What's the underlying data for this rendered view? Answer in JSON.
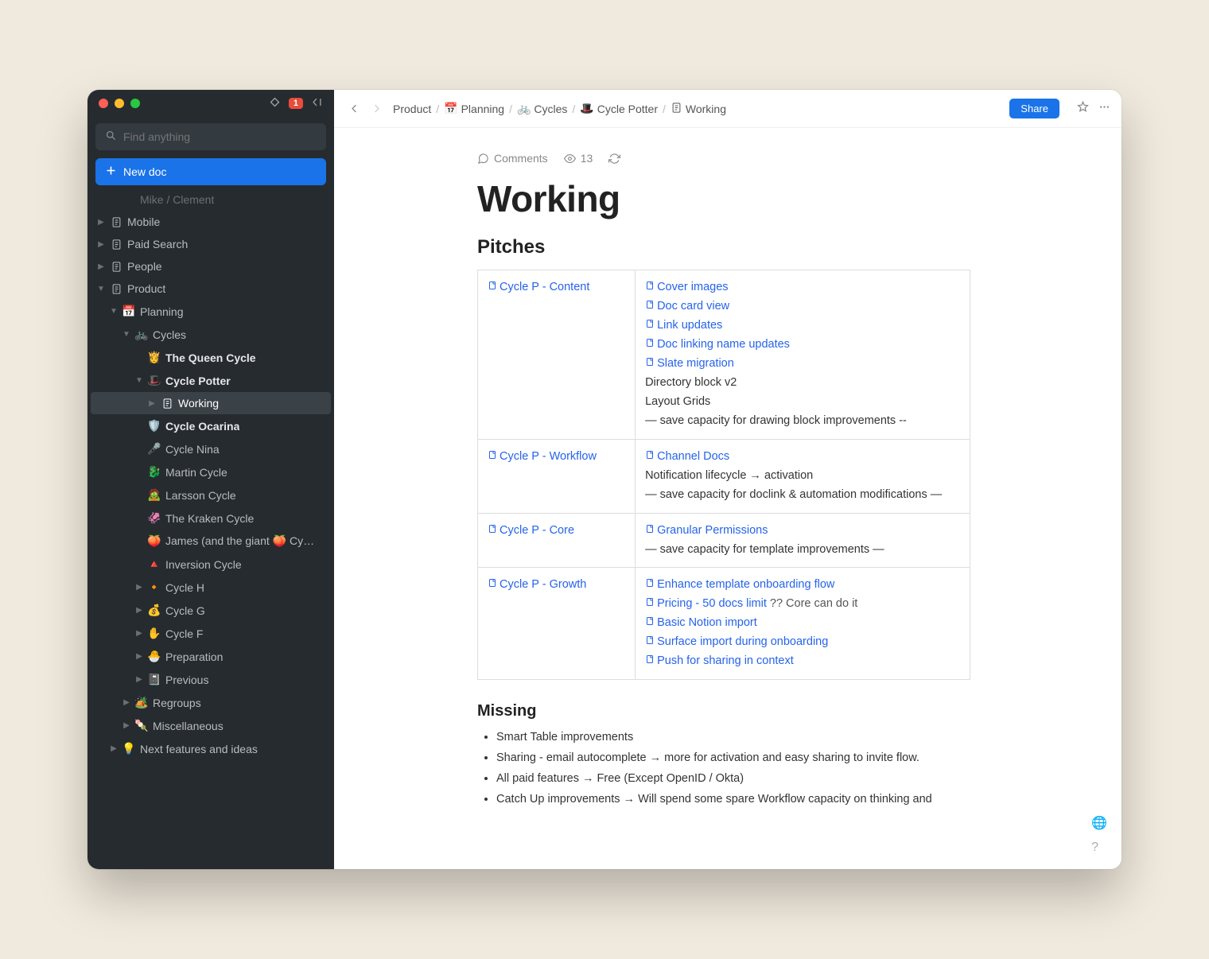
{
  "window": {
    "notification_count": "1"
  },
  "search": {
    "placeholder": "Find anything"
  },
  "new_doc_label": "New doc",
  "sidebar": {
    "cutoff": "Mike / Clement",
    "items": [
      {
        "label": "Mobile",
        "indent": 0,
        "chev": "▶",
        "icon": "doc"
      },
      {
        "label": "Paid Search",
        "indent": 0,
        "chev": "▶",
        "icon": "doc"
      },
      {
        "label": "People",
        "indent": 0,
        "chev": "▶",
        "icon": "doc"
      },
      {
        "label": "Product",
        "indent": 0,
        "chev": "▼",
        "icon": "doc"
      },
      {
        "label": "Planning",
        "indent": 1,
        "chev": "▼",
        "icon": "📅"
      },
      {
        "label": "Cycles",
        "indent": 2,
        "chev": "▼",
        "icon": "🚲"
      },
      {
        "label": "The Queen Cycle",
        "indent": 3,
        "chev": "",
        "icon": "👸",
        "bold": true
      },
      {
        "label": "Cycle Potter",
        "indent": 3,
        "chev": "▼",
        "icon": "🎩",
        "bold": true
      },
      {
        "label": "Working",
        "indent": 4,
        "chev": "▶",
        "icon": "doc",
        "active": true
      },
      {
        "label": "Cycle Ocarina",
        "indent": 3,
        "chev": "",
        "icon": "🛡️",
        "bold": true
      },
      {
        "label": "Cycle Nina",
        "indent": 3,
        "chev": "",
        "icon": "🎤"
      },
      {
        "label": "Martin Cycle",
        "indent": 3,
        "chev": "",
        "icon": "🐉"
      },
      {
        "label": "Larsson Cycle",
        "indent": 3,
        "chev": "",
        "icon": "🧟"
      },
      {
        "label": "The Kraken Cycle",
        "indent": 3,
        "chev": "",
        "icon": "🦑"
      },
      {
        "label": "James (and the giant 🍑 Cy…",
        "indent": 3,
        "chev": "",
        "icon": "🍑"
      },
      {
        "label": "Inversion Cycle",
        "indent": 3,
        "chev": "",
        "icon": "🔺"
      },
      {
        "label": "Cycle H",
        "indent": 3,
        "chev": "▶",
        "icon": "🔸"
      },
      {
        "label": "Cycle G",
        "indent": 3,
        "chev": "▶",
        "icon": "💰"
      },
      {
        "label": "Cycle F",
        "indent": 3,
        "chev": "▶",
        "icon": "✋"
      },
      {
        "label": "Preparation",
        "indent": 3,
        "chev": "▶",
        "icon": "🐣"
      },
      {
        "label": "Previous",
        "indent": 3,
        "chev": "▶",
        "icon": "📓"
      },
      {
        "label": "Regroups",
        "indent": 2,
        "chev": "▶",
        "icon": "🏕️"
      },
      {
        "label": "Miscellaneous",
        "indent": 2,
        "chev": "▶",
        "icon": "🍡"
      },
      {
        "label": "Next features and ideas",
        "indent": 1,
        "chev": "▶",
        "icon": "💡"
      }
    ]
  },
  "breadcrumb": [
    {
      "label": "Product",
      "icon": ""
    },
    {
      "label": "Planning",
      "icon": "📅"
    },
    {
      "label": "Cycles",
      "icon": "🚲"
    },
    {
      "label": "Cycle Potter",
      "icon": "🎩"
    },
    {
      "label": "Working",
      "icon": "doc"
    }
  ],
  "share_label": "Share",
  "meta": {
    "comments_label": "Comments",
    "views": "13"
  },
  "doc": {
    "title": "Working",
    "h2": "Pitches",
    "h3": "Missing"
  },
  "pitches": [
    {
      "name": "Cycle P - Content",
      "items": [
        {
          "type": "link",
          "text": "Cover images"
        },
        {
          "type": "link",
          "text": "Doc card view"
        },
        {
          "type": "link",
          "text": "Link updates"
        },
        {
          "type": "link",
          "text": "Doc linking name updates"
        },
        {
          "type": "link",
          "text": "Slate migration"
        },
        {
          "type": "plain",
          "text": "Directory block v2"
        },
        {
          "type": "plain",
          "text": "Layout Grids"
        },
        {
          "type": "plain",
          "text": "— save capacity for drawing block improvements --"
        }
      ]
    },
    {
      "name": "Cycle P - Workflow",
      "items": [
        {
          "type": "link",
          "text": "Channel Docs"
        },
        {
          "type": "plain",
          "text": "Notification lifecycle → activation"
        },
        {
          "type": "plain",
          "text": "— save capacity for doclink & automation modifications —"
        }
      ]
    },
    {
      "name": "Cycle P - Core",
      "items": [
        {
          "type": "link",
          "text": "Granular Permissions"
        },
        {
          "type": "plain",
          "text": "— save capacity for template improvements —"
        }
      ]
    },
    {
      "name": "Cycle P - Growth",
      "items": [
        {
          "type": "link",
          "text": "Enhance template onboarding flow"
        },
        {
          "type": "linknote",
          "text": "Pricing - 50 docs limit",
          "note": "  ?? Core can do it"
        },
        {
          "type": "link",
          "text": "Basic Notion import"
        },
        {
          "type": "link",
          "text": "Surface import during onboarding"
        },
        {
          "type": "link",
          "text": "Push for sharing in context"
        }
      ]
    }
  ],
  "missing": [
    "Smart Table improvements",
    "Sharing - email autocomplete → more for activation and easy sharing to invite flow.",
    "All paid features → Free (Except OpenID / Okta)",
    "Catch Up improvements → Will spend some spare Workflow capacity on thinking and"
  ]
}
